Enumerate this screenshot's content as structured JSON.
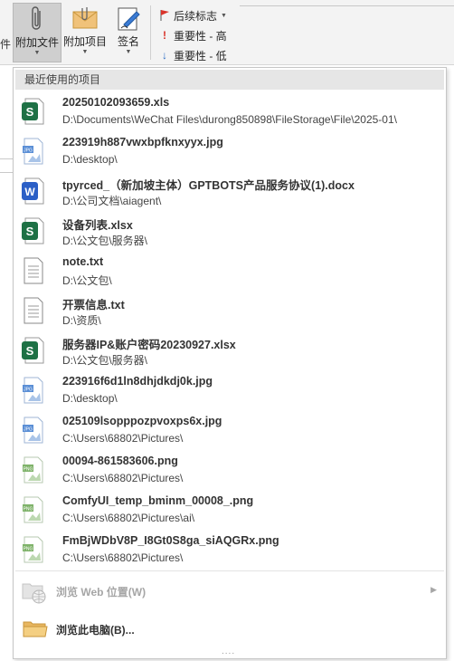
{
  "ribbon": {
    "left_edge_label": "件",
    "attach_file_label": "附加文件",
    "attach_item_label": "附加项目",
    "signature_label": "签名",
    "followup_label": "后续标志",
    "importance_high_label": "重要性 - 高",
    "importance_low_label": "重要性 - 低"
  },
  "menu": {
    "header": "最近使用的项目",
    "items": [
      {
        "name": "20250102093659.xls",
        "path": "D:\\Documents\\WeChat Files\\durong850898\\FileStorage\\File\\2025-01\\",
        "type": "excel"
      },
      {
        "name": "223919h887vwxbpfknxyyx.jpg",
        "path": "D:\\desktop\\",
        "type": "jpg"
      },
      {
        "name": "tpyrced_（新加坡主体）GPTBOTS产品服务协议(1).docx",
        "path": "D:\\公司文档\\aiagent\\",
        "type": "word"
      },
      {
        "name": "设备列表.xlsx",
        "path": "D:\\公文包\\服务器\\",
        "type": "excel"
      },
      {
        "name": "note.txt",
        "path": "D:\\公文包\\",
        "type": "txt"
      },
      {
        "name": "开票信息.txt",
        "path": "D:\\资质\\",
        "type": "txt"
      },
      {
        "name": "服务器IP&账户密码20230927.xlsx",
        "path": "D:\\公文包\\服务器\\",
        "type": "excel"
      },
      {
        "name": "223916f6d1ln8dhjdkdj0k.jpg",
        "path": "D:\\desktop\\",
        "type": "jpg"
      },
      {
        "name": "025109lsopppozpvoxps6x.jpg",
        "path": "C:\\Users\\68802\\Pictures\\",
        "type": "jpg"
      },
      {
        "name": "00094-861583606.png",
        "path": "C:\\Users\\68802\\Pictures\\",
        "type": "png"
      },
      {
        "name": "ComfyUI_temp_bminm_00008_.png",
        "path": "C:\\Users\\68802\\Pictures\\ai\\",
        "type": "png"
      },
      {
        "name": "FmBjWDbV8P_I8Gt0S8ga_siAQGRx.png",
        "path": "C:\\Users\\68802\\Pictures\\",
        "type": "png"
      }
    ],
    "browse_web_label": "浏览 Web 位置(W)",
    "browse_pc_label": "浏览此电脑(B)...",
    "grip": "....",
    "colors": {
      "excel": "#1e7145",
      "word": "#2b5fc6",
      "jpg": "#5b8fd6",
      "png": "#7fb36a",
      "header_bg": "#e6e6e6"
    }
  }
}
